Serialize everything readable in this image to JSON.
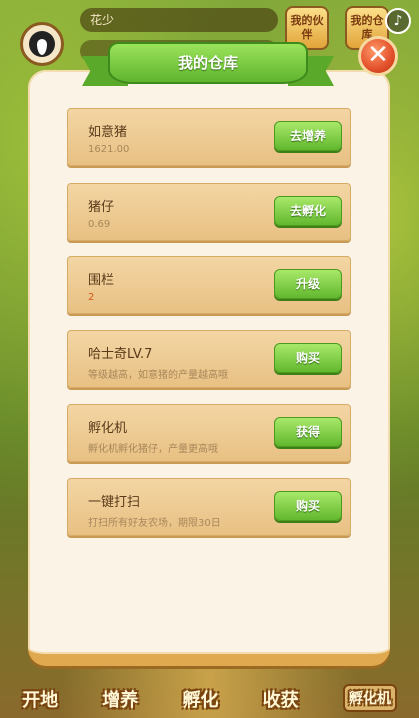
{
  "header": {
    "name": "花少",
    "buttons": [
      "我的伙伴",
      "我的仓库"
    ],
    "music_icon": "music-note-icon"
  },
  "dialog": {
    "title": "我的仓库",
    "close_icon": "close-icon",
    "items": [
      {
        "title": "如意猪",
        "sub": "1621.00",
        "button": "去增养"
      },
      {
        "title": "猪仔",
        "sub": "0.69",
        "button": "去孵化"
      },
      {
        "title": "围栏",
        "sub": "2",
        "button": "升级"
      },
      {
        "title": "哈士奇LV.7",
        "sub": "等级越高，如意猪的产量越高哦",
        "button": "购买"
      },
      {
        "title": "孵化机",
        "sub": "孵化机孵化猪仔，产量更高哦",
        "button": "获得"
      },
      {
        "title": "一键打扫",
        "sub": "打扫所有好友农场，期限30日",
        "button": "购买"
      }
    ]
  },
  "bottom_nav": [
    "开地",
    "增养",
    "孵化",
    "收获",
    "孵化机"
  ],
  "colors": {
    "accent_green": "#62b82e",
    "panel": "#fbf3e6",
    "item": "#e8c083"
  }
}
